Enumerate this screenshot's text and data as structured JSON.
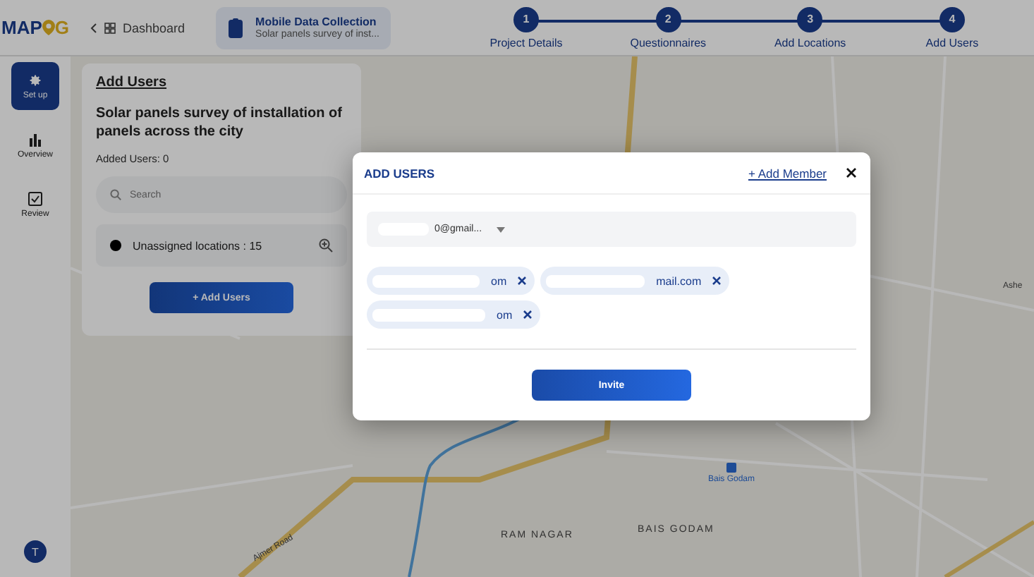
{
  "logo": {
    "left": "MAP",
    "right": "G"
  },
  "breadcrumb": {
    "back": "Dashboard"
  },
  "project": {
    "title": "Mobile Data Collection",
    "subtitle": "Solar panels survey of inst..."
  },
  "steps": [
    {
      "number": "1",
      "label": "Project Details",
      "completed": true
    },
    {
      "number": "2",
      "label": "Questionnaires",
      "completed": true
    },
    {
      "number": "3",
      "label": "Add Locations",
      "completed": true
    },
    {
      "number": "4",
      "label": "Add Users",
      "completed": true
    }
  ],
  "sidebar": {
    "items": [
      {
        "kind": "gear",
        "label": "Set up",
        "selected": true
      },
      {
        "kind": "chart",
        "label": "Overview",
        "selected": false
      },
      {
        "kind": "check",
        "label": "Review",
        "selected": false
      }
    ],
    "avatar": "T"
  },
  "panel": {
    "heading": "Add Users",
    "project_name": "Solar panels survey of installation of panels across the city",
    "added_users": "Added Users: 0",
    "search": {
      "placeholder": "Search"
    },
    "location_group": {
      "label": "Unassigned locations : 15",
      "color": "#000000"
    },
    "button": "+ Add Users"
  },
  "map": {
    "labels": [
      {
        "kind": "road",
        "text": "Ajmer Road"
      },
      {
        "kind": "area",
        "text": "RAM NAGAR"
      },
      {
        "kind": "area",
        "text": "BAIS GODAM"
      },
      {
        "kind": "station",
        "text": "Bais Godam"
      },
      {
        "kind": "edge",
        "text": "Ashe"
      }
    ]
  },
  "dialog": {
    "title": "ADD USERS",
    "add_member": "+ Add Member",
    "select": {
      "value": "0@gmail..."
    },
    "chips": [
      {
        "text": "om"
      },
      {
        "text": "mail.com"
      },
      {
        "text": "om"
      }
    ],
    "button": "Invite"
  }
}
